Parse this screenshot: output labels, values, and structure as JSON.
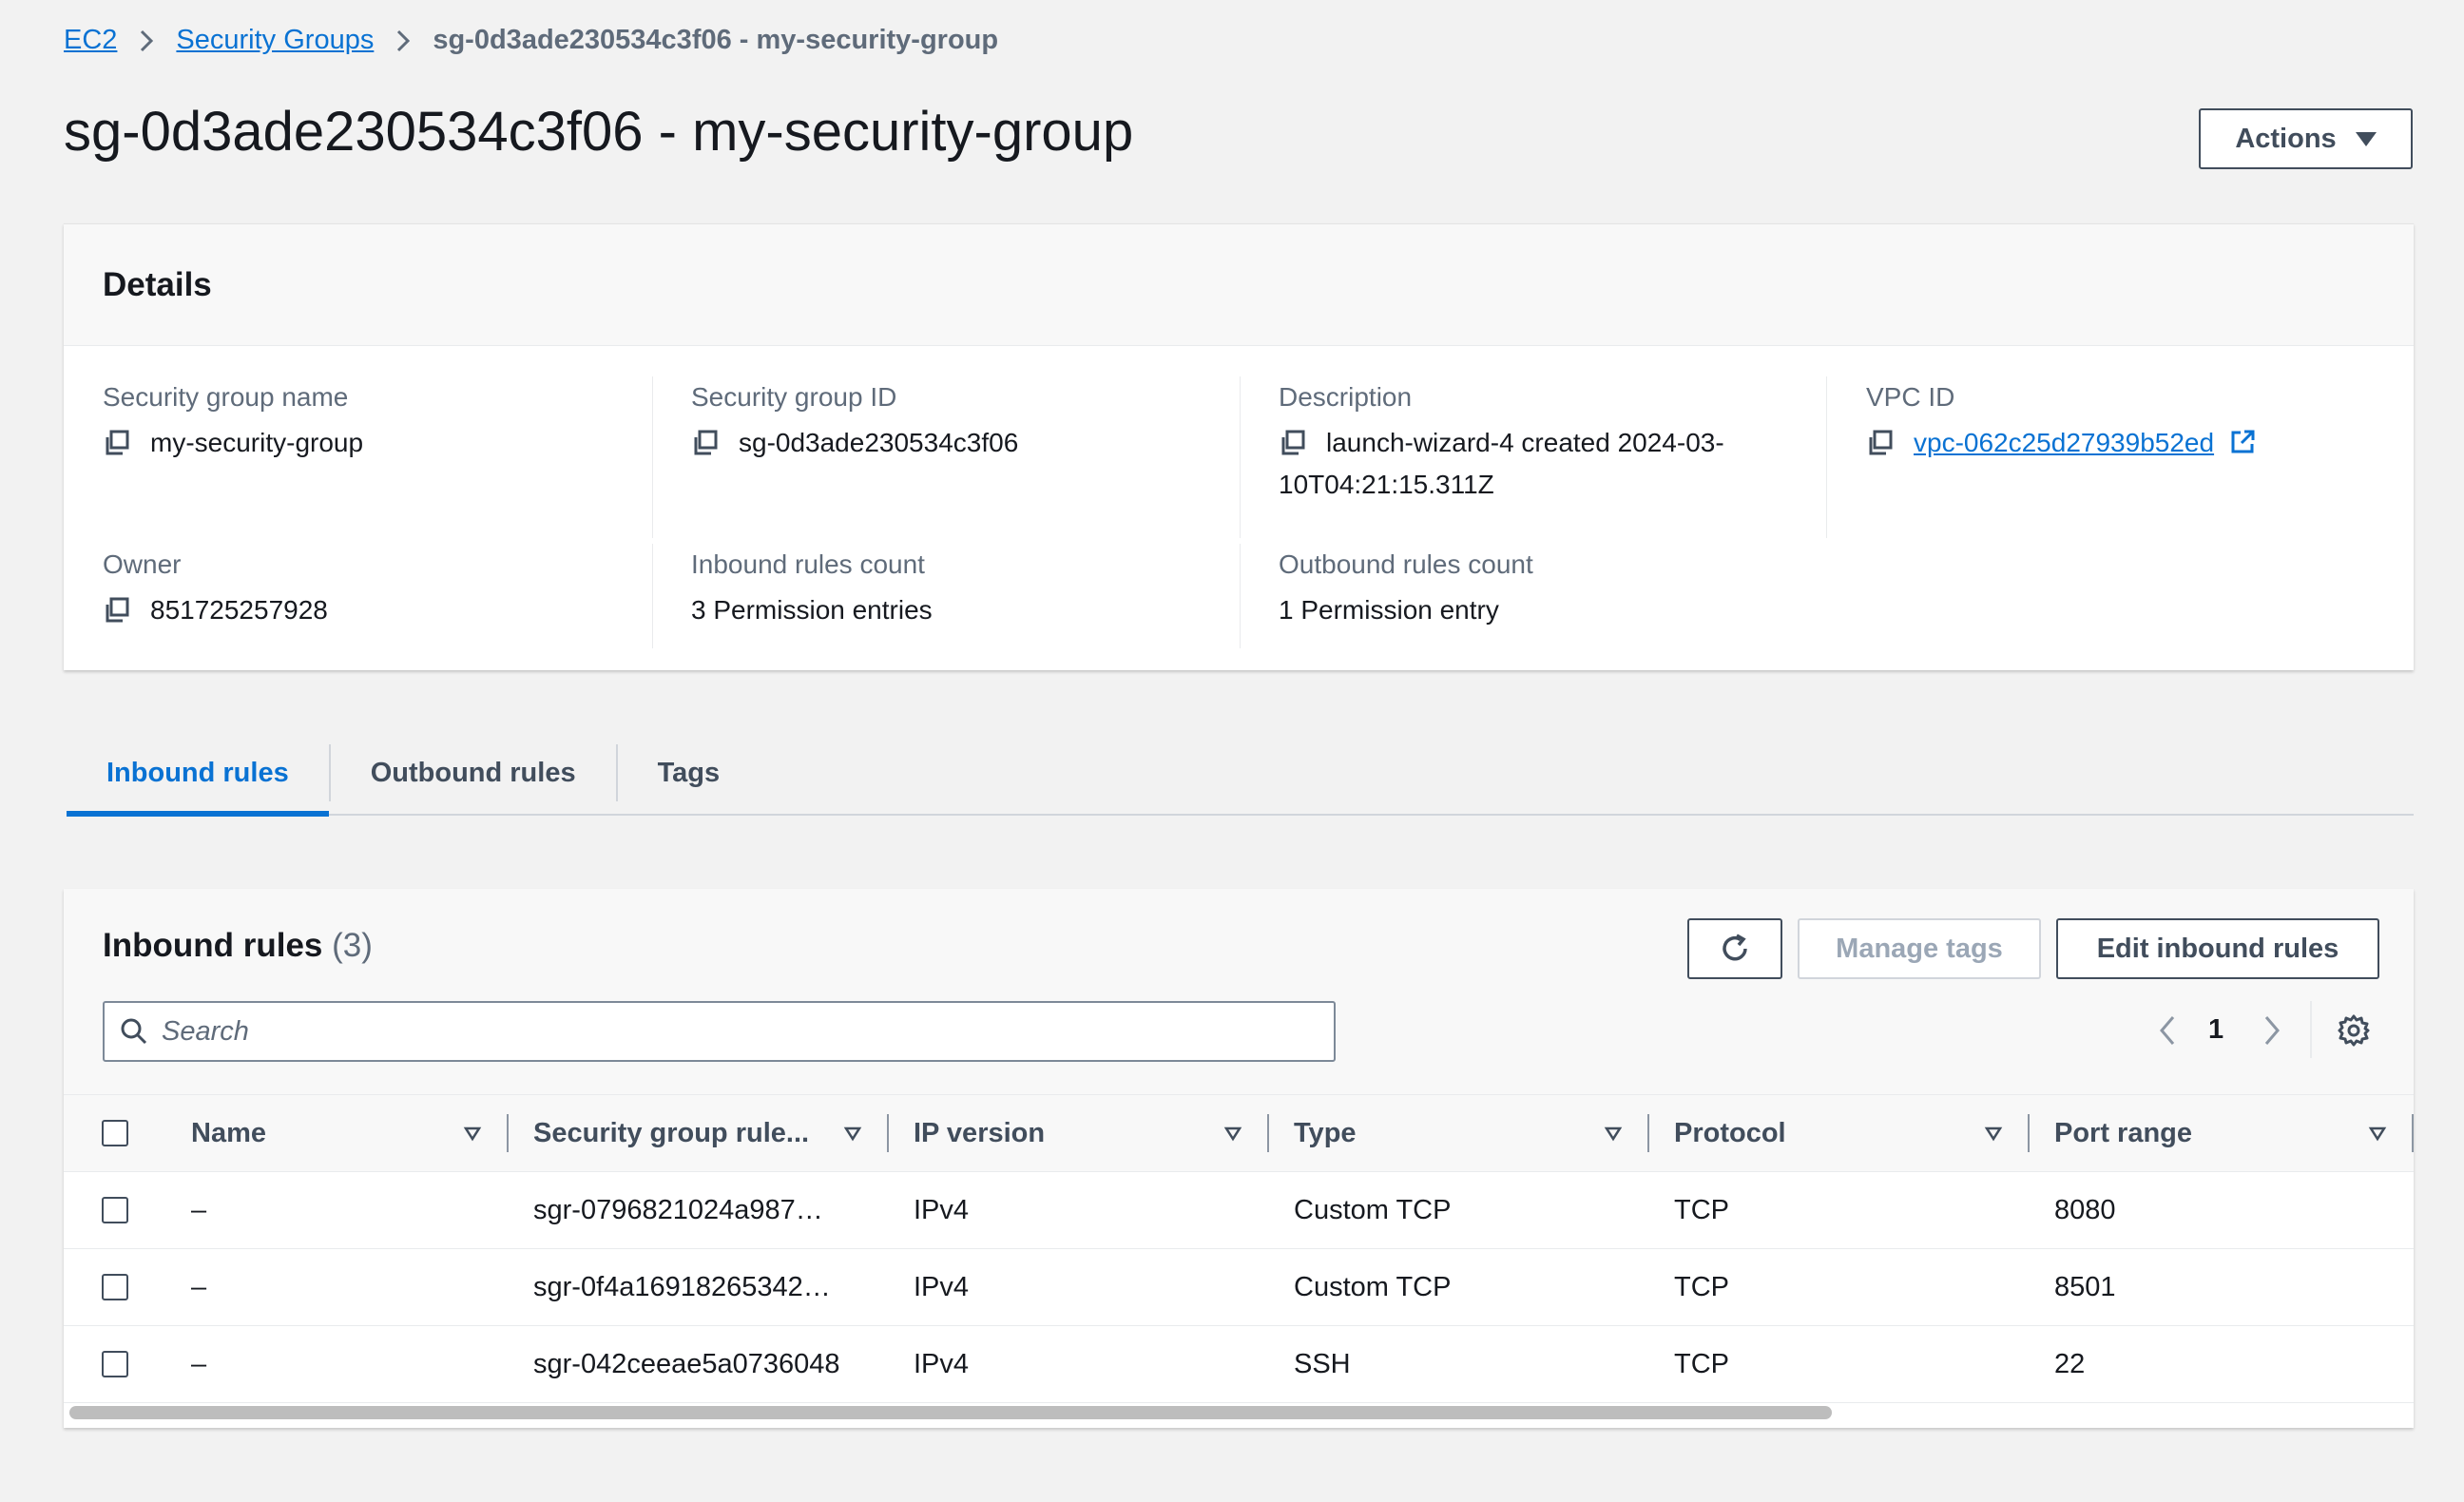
{
  "breadcrumb": {
    "root": "EC2",
    "parent": "Security Groups",
    "current": "sg-0d3ade230534c3f06 - my-security-group"
  },
  "page": {
    "title": "sg-0d3ade230534c3f06 - my-security-group",
    "actions_label": "Actions"
  },
  "details": {
    "heading": "Details",
    "sg_name_label": "Security group name",
    "sg_name_value": "my-security-group",
    "sg_id_label": "Security group ID",
    "sg_id_value": "sg-0d3ade230534c3f06",
    "description_label": "Description",
    "description_line1": "launch-wizard-4 created 2024-03-",
    "description_line2": "10T04:21:15.311Z",
    "vpc_label": "VPC ID",
    "vpc_value": "vpc-062c25d27939b52ed",
    "owner_label": "Owner",
    "owner_value": "851725257928",
    "inbound_count_label": "Inbound rules count",
    "inbound_count_value": "3 Permission entries",
    "outbound_count_label": "Outbound rules count",
    "outbound_count_value": "1 Permission entry"
  },
  "tabs": [
    {
      "label": "Inbound rules",
      "active": true
    },
    {
      "label": "Outbound rules",
      "active": false
    },
    {
      "label": "Tags",
      "active": false
    }
  ],
  "rules": {
    "title": "Inbound rules",
    "count": "(3)",
    "manage_tags_label": "Manage tags",
    "edit_label": "Edit inbound rules",
    "search_placeholder": "Search",
    "page_number": "1",
    "columns": [
      "Name",
      "Security group rule...",
      "IP version",
      "Type",
      "Protocol",
      "Port range"
    ],
    "rows": [
      {
        "name": "–",
        "rule_id": "sgr-0796821024a987…",
        "ip_version": "IPv4",
        "type": "Custom TCP",
        "protocol": "TCP",
        "port_range": "8080"
      },
      {
        "name": "–",
        "rule_id": "sgr-0f4a16918265342…",
        "ip_version": "IPv4",
        "type": "Custom TCP",
        "protocol": "TCP",
        "port_range": "8501"
      },
      {
        "name": "–",
        "rule_id": "sgr-042ceeae5a0736048",
        "ip_version": "IPv4",
        "type": "SSH",
        "protocol": "TCP",
        "port_range": "22"
      }
    ]
  },
  "colors": {
    "link": "#0972d3",
    "text": "#16191f",
    "muted": "#5f6b7a",
    "background": "#f2f2f2"
  },
  "icons": [
    "chevron-right-icon",
    "caret-down-icon",
    "copy-icon",
    "external-link-icon",
    "refresh-icon",
    "search-icon",
    "chevron-left-icon",
    "settings-icon",
    "sort-icon"
  ]
}
